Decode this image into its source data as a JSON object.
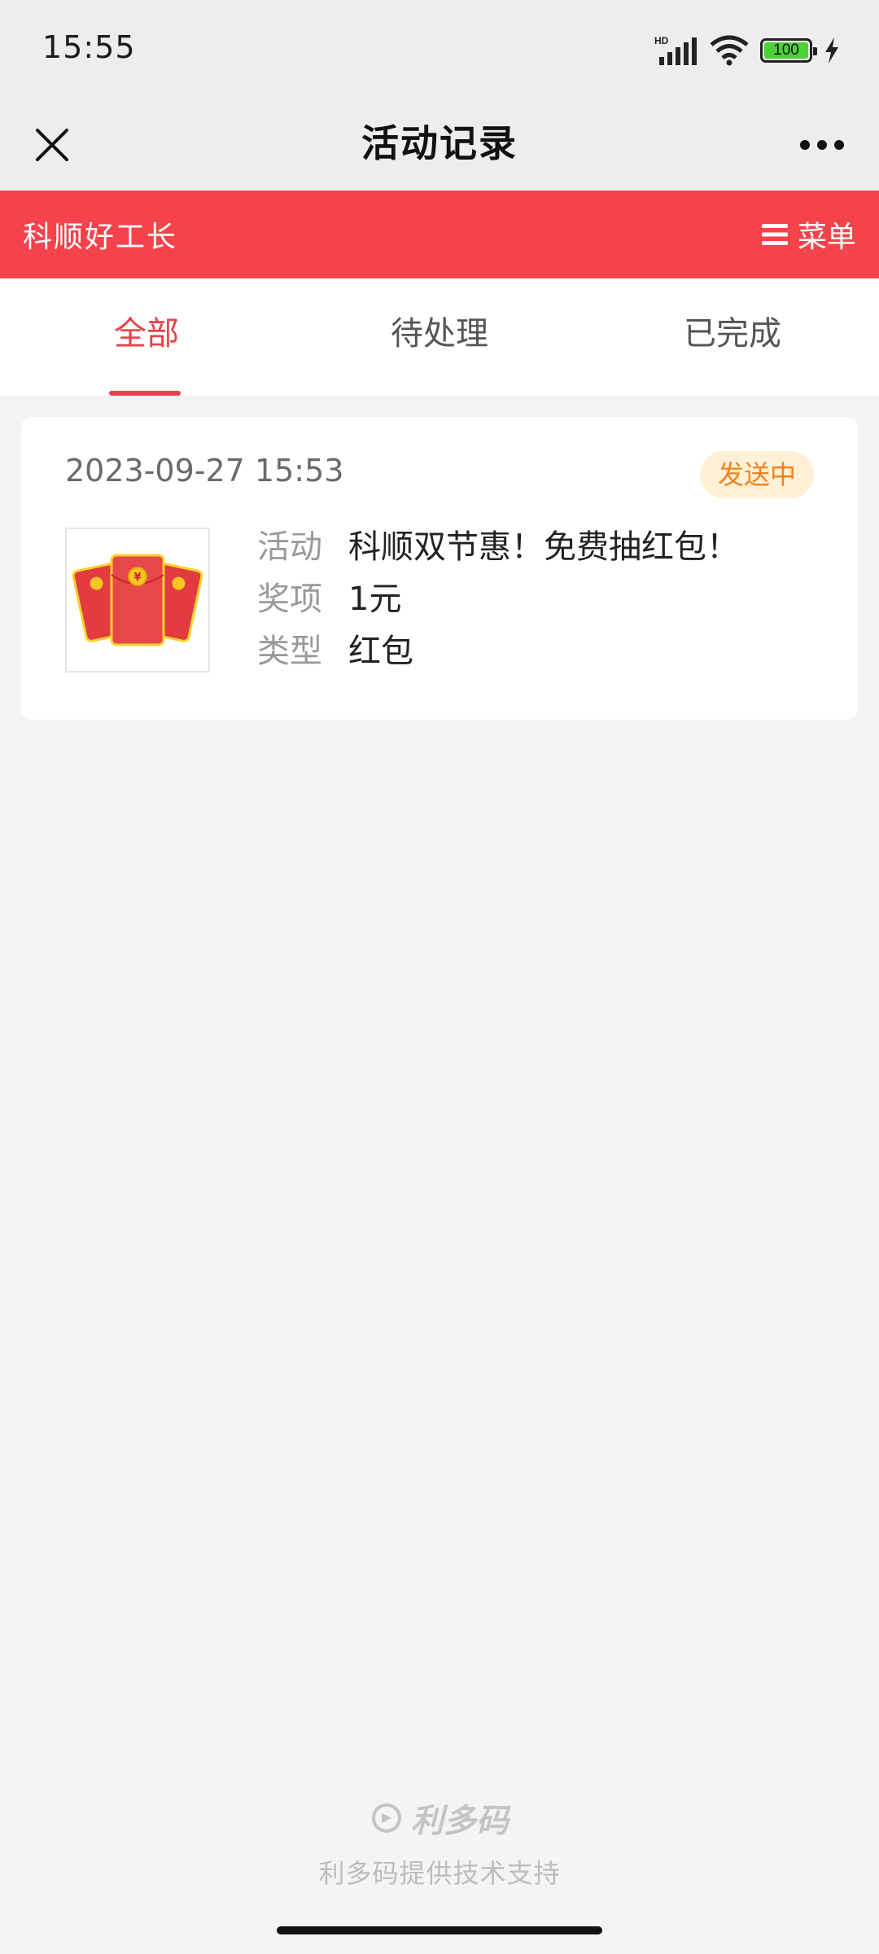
{
  "status_bar": {
    "time": "15:55",
    "battery": "100",
    "icons": [
      "hd-signal-icon",
      "wifi-icon",
      "battery-icon",
      "charging-icon"
    ]
  },
  "nav": {
    "title": "活动记录",
    "close_icon": "close-icon",
    "more_icon": "more-icon"
  },
  "brand": {
    "name": "科顺好工长",
    "menu_label": "菜单",
    "color": "#f6434b"
  },
  "tabs": [
    {
      "label": "全部",
      "active": true
    },
    {
      "label": "待处理",
      "active": false
    },
    {
      "label": "已完成",
      "active": false
    }
  ],
  "record": {
    "date": "2023-09-27 15:53",
    "status": "发送中",
    "rows": [
      {
        "label": "活动",
        "value": "科顺双节惠！免费抽红包！"
      },
      {
        "label": "奖项",
        "value": "1元"
      },
      {
        "label": "类型",
        "value": "红包"
      }
    ]
  },
  "footer": {
    "logo_text": "利多码",
    "support_text": "利多码提供技术支持"
  }
}
